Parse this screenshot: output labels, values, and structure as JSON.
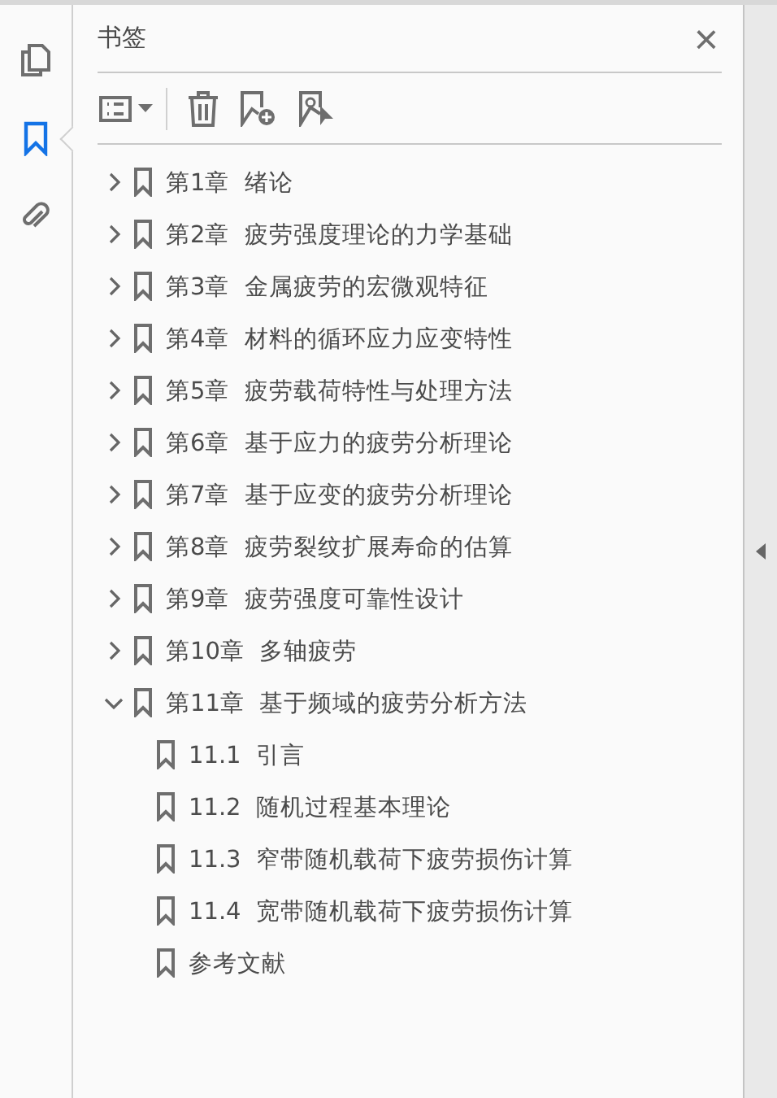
{
  "rail": [
    {
      "kind": "pages",
      "selected": false
    },
    {
      "kind": "bookmarks",
      "selected": true
    },
    {
      "kind": "attachments",
      "selected": false
    }
  ],
  "panel": {
    "title": "书签",
    "close": "×"
  },
  "toolbar": [
    {
      "kind": "options"
    },
    {
      "kind": "delete"
    },
    {
      "kind": "new"
    },
    {
      "kind": "find"
    }
  ],
  "bookmarks": [
    {
      "label": "第1章  绪论",
      "expanded": false
    },
    {
      "label": "第2章  疲劳强度理论的力学基础",
      "expanded": false
    },
    {
      "label": "第3章  金属疲劳的宏微观特征",
      "expanded": false
    },
    {
      "label": "第4章  材料的循环应力应变特性",
      "expanded": false
    },
    {
      "label": "第5章  疲劳载荷特性与处理方法",
      "expanded": false
    },
    {
      "label": "第6章  基于应力的疲劳分析理论",
      "expanded": false
    },
    {
      "label": "第7章  基于应变的疲劳分析理论",
      "expanded": false
    },
    {
      "label": "第8章  疲劳裂纹扩展寿命的估算",
      "expanded": false
    },
    {
      "label": "第9章  疲劳强度可靠性设计",
      "expanded": false
    },
    {
      "label": "第10章  多轴疲劳",
      "expanded": false
    },
    {
      "label": "第11章  基于频域的疲劳分析方法",
      "expanded": true,
      "children": [
        {
          "label": "11.1  引言"
        },
        {
          "label": "11.2  随机过程基本理论"
        },
        {
          "label": "11.3  窄带随机载荷下疲劳损伤计算"
        },
        {
          "label": "11.4  宽带随机载荷下疲劳损伤计算"
        },
        {
          "label": "参考文献"
        }
      ]
    }
  ]
}
